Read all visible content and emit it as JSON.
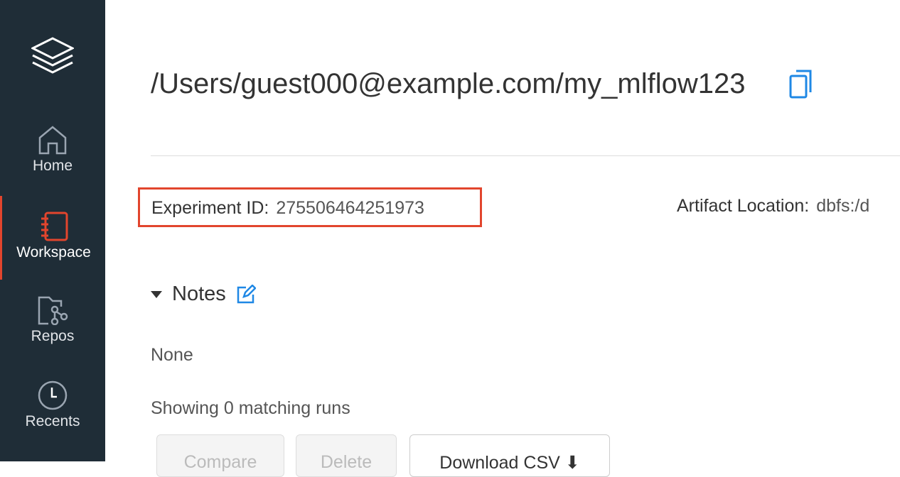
{
  "sidebar": {
    "items": [
      {
        "label": "Home"
      },
      {
        "label": "Workspace"
      },
      {
        "label": "Repos"
      },
      {
        "label": "Recents"
      }
    ]
  },
  "header": {
    "title": "/Users/guest000@example.com/my_mlflow123"
  },
  "info": {
    "experiment_id_label": "Experiment ID:",
    "experiment_id": "275506464251973",
    "artifact_label": "Artifact Location:",
    "artifact_value": "dbfs:/d"
  },
  "notes": {
    "label": "Notes",
    "content": "None"
  },
  "runs": {
    "status": "Showing 0 matching runs",
    "compare": "Compare",
    "delete": "Delete",
    "download": "Download CSV"
  },
  "colors": {
    "accent": "#e2452d",
    "sidebar": "#1f2d37",
    "link": "#1f88e5"
  }
}
